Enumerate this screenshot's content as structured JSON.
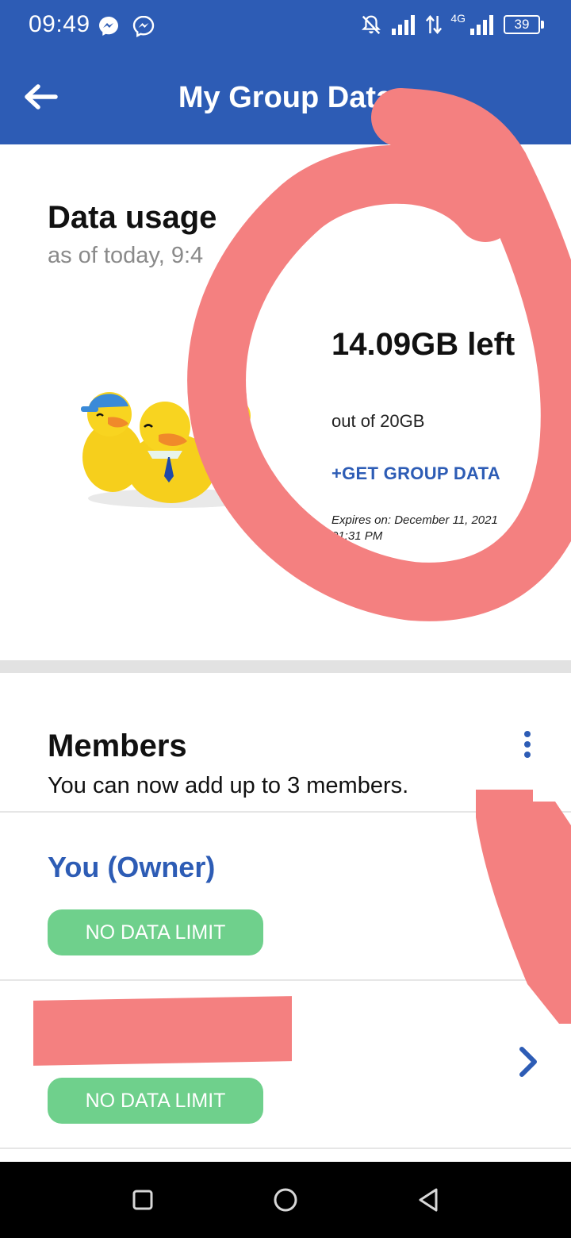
{
  "status_bar": {
    "time": "09:49",
    "battery": "39",
    "network_label": "4G",
    "icons": [
      "messenger-icon",
      "messenger-icon",
      "mute-icon",
      "signal-icon",
      "data-arrows-icon",
      "signal-icon",
      "battery-icon"
    ]
  },
  "app_bar": {
    "title": "My Group Data",
    "back_icon": "back-arrow-icon"
  },
  "usage": {
    "title": "Data usage",
    "subtitle": "as of today, 9:4",
    "remaining": "14.09GB left",
    "total": "out of 20GB",
    "get_group_data": "+GET GROUP DATA",
    "expires": "Expires on: December 11, 2021 01:31 PM",
    "illustration": "ducks-illustration"
  },
  "members": {
    "title": "Members",
    "subtitle": "You can now add up to 3 members.",
    "more_icon": "more-vertical-icon",
    "list": [
      {
        "name": "You (Owner)",
        "limit": "NO DATA LIMIT"
      },
      {
        "name": "",
        "limit": "NO DATA LIMIT",
        "redacted": true
      }
    ]
  },
  "colors": {
    "brand_blue": "#2d5cb5",
    "pill_green": "#6fd08c",
    "annotation_red": "#f48080"
  },
  "nav_bar": {
    "icons": [
      "recents-square-icon",
      "home-circle-icon",
      "back-triangle-icon"
    ]
  }
}
